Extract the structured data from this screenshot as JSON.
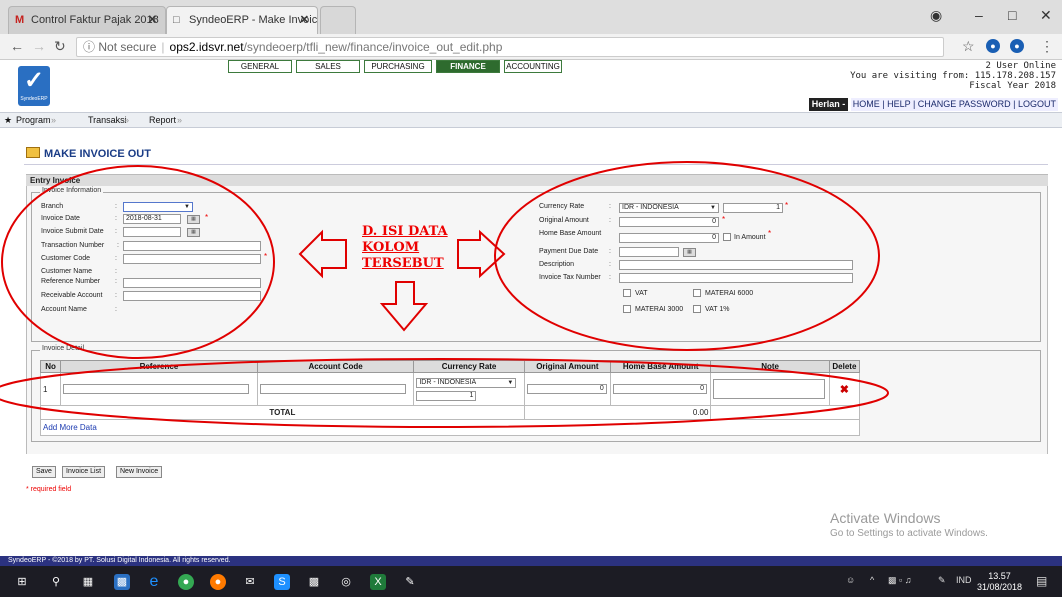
{
  "browser": {
    "tabs": [
      {
        "favicon": "M",
        "label": "Control Faktur Pajak 2018"
      },
      {
        "favicon": "□",
        "label": "SyndeoERP - Make Invoic"
      }
    ],
    "tab_close": "✕",
    "not_secure": "Not secure",
    "url_host": "ops2.idsvr.net",
    "url_path": "/syndeoerp/tfli_new/finance/invoice_out_edit.php"
  },
  "app": {
    "logo_text": "SyndeoERP",
    "modules": [
      "GENERAL",
      "SALES",
      "PURCHASING",
      "FINANCE",
      "ACCOUNTING"
    ],
    "active_module": "FINANCE",
    "users_online": "2 User Online",
    "visiting": "You are visiting from: 115.178.208.157",
    "fiscal_year": "Fiscal Year 2018",
    "user_name": "Herlan -",
    "user_links": "HOME | HELP | CHANGE PASSWORD | LOGOUT",
    "menu": [
      "Program",
      "Transaksi",
      "Report"
    ],
    "menu_arrow": "»"
  },
  "page": {
    "title": "MAKE INVOICE OUT",
    "section": "Entry Invoice",
    "info_legend": "Invoice Information",
    "left_fields": {
      "branch": "Branch",
      "invoice_date": "Invoice Date",
      "invoice_date_value": "2018-08-31",
      "invoice_submit_date": "Invoice Submit Date",
      "transaction_number": "Transaction Number",
      "customer_code": "Customer Code",
      "customer_name": "Customer Name",
      "reference_number": "Reference Number",
      "receivable_account": "Receivable Account",
      "account_name": "Account Name"
    },
    "right_fields": {
      "currency_rate": "Currency Rate",
      "currency_value": "IDR - INDONESIA",
      "currency_rate_value": "1",
      "original_amount": "Original Amount",
      "original_amount_value": "0",
      "home_base_amount": "Home Base Amount",
      "home_base_amount_value": "0",
      "in_amount": "In Amount",
      "payment_due_date": "Payment Due Date",
      "description": "Description",
      "invoice_tax_number": "Invoice Tax Number",
      "vat": "VAT",
      "materai_6000": "MATERAI 6000",
      "materai_3000": "MATERAI 3000",
      "vat_1": "VAT 1%"
    },
    "detail_legend": "Invoice Detail",
    "detail_headers": [
      "No",
      "Reference",
      "Account Code",
      "Currency Rate",
      "Original Amount",
      "Home Base Amount",
      "Note",
      "Delete"
    ],
    "detail_row": {
      "no": "1",
      "currency": "IDR - INDONESIA",
      "rate": "1",
      "original": "0",
      "home": "0"
    },
    "total_label": "TOTAL",
    "total_value": "0.00",
    "add_more": "Add More Data",
    "buttons": [
      "Save",
      "Invoice List",
      "New Invoice"
    ],
    "required_note": "* required field"
  },
  "annotation": {
    "line1": "D. ISI DATA",
    "line2": "KOLOM",
    "line3": "TERSEBUT"
  },
  "windows": {
    "activate_title": "Activate Windows",
    "activate_sub": "Go to Settings to activate Windows.",
    "footer": "SyndeoERP - ©2018 by PT. Solusi Digital Indonesia. All rights reserved.",
    "lang": "IND",
    "time": "13.57",
    "date": "31/08/2018"
  },
  "colors": {
    "accent_green": "#2e6b2e",
    "annotation_red": "#e00000",
    "footer_blue": "#2b3280"
  }
}
